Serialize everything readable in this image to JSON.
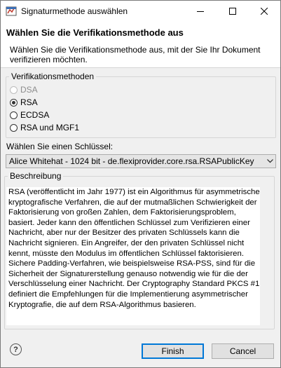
{
  "window": {
    "title": "Signaturmethode auswählen"
  },
  "header": {
    "title": "Wählen Sie die Verifikationsmethode aus",
    "description": "Wählen Sie die Verifikationsmethode aus, mit der Sie Ihr Dokument verifizieren möchten."
  },
  "methods": {
    "group_label": "Verifikationsmethoden",
    "options": [
      {
        "label": "DSA",
        "selected": false,
        "enabled": false
      },
      {
        "label": "RSA",
        "selected": true,
        "enabled": true
      },
      {
        "label": "ECDSA",
        "selected": false,
        "enabled": true
      },
      {
        "label": "RSA und MGF1",
        "selected": false,
        "enabled": true
      }
    ]
  },
  "key": {
    "label": "Wählen Sie einen Schlüssel:",
    "selected_value": "Alice Whitehat - 1024 bit - de.flexiprovider.core.rsa.RSAPublicKey"
  },
  "description_group": {
    "label": "Beschreibung",
    "text": "RSA (veröffentlicht im Jahr 1977) ist ein Algorithmus für asymmetrische kryptografische Verfahren, die auf der mutmaßlichen Schwierigkeit der Faktorisierung von großen Zahlen, dem Faktorisierungsproblem, basiert. Jeder kann den öffentlichen Schlüssel zum Verifizieren einer Nachricht, aber nur der Besitzer des privaten Schlüssels kann die Nachricht signieren. Ein Angreifer, der den privaten Schlüssel nicht kennt, müsste den Modulus im öffentlichen Schlüssel faktorisieren. Sichere Padding-Verfahren, wie beispielsweise RSA-PSS, sind für die Sicherheit der Signaturerstellung genauso notwendig wie für die der Verschlüsselung einer Nachricht. Der Cryptography Standard PKCS #1 definiert die Empfehlungen für die Implementierung asymmetrischer Kryptografie, die auf dem RSA-Algorithmus basieren."
  },
  "buttons": {
    "help_icon": "question-icon",
    "finish": "Finish",
    "cancel": "Cancel"
  },
  "colors": {
    "primary_border": "#0078d7"
  }
}
